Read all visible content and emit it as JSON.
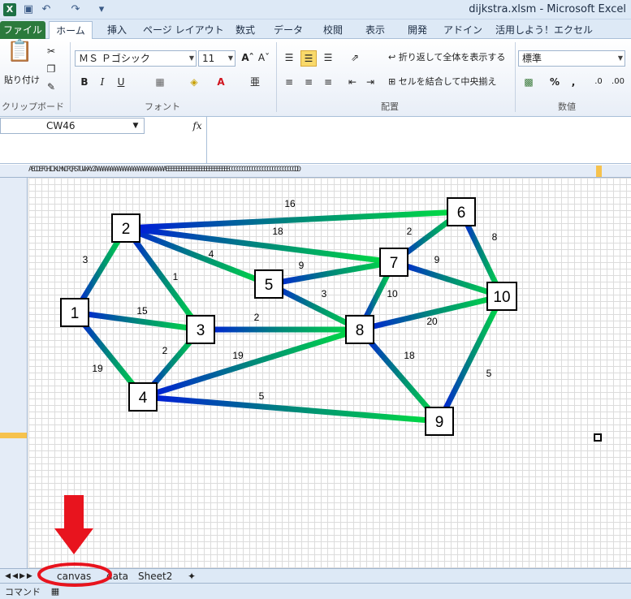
{
  "window": {
    "title": "dijkstra.xlsm - Microsoft Excel"
  },
  "ribbon": {
    "tabs": [
      "ファイル",
      "ホーム",
      "挿入",
      "ページ レイアウト",
      "数式",
      "データ",
      "校閲",
      "表示",
      "開発",
      "アドイン",
      "活用しよう！エクセル"
    ],
    "clipboard": {
      "paste_label": "貼り付け",
      "group_label": "クリップボード"
    },
    "font": {
      "name": "ＭＳ Ｐゴシック",
      "size": "11",
      "group_label": "フォント"
    },
    "alignment": {
      "wrap_label": "折り返して全体を表示する",
      "merge_label": "セルを結合して中央揃え",
      "group_label": "配置"
    },
    "number": {
      "format": "標準",
      "group_label": "数値"
    }
  },
  "formula_bar": {
    "name_box": "CW46",
    "fx": "fx",
    "formula": ""
  },
  "column_header_letters": "AECDEFGHIJKLMNOPQRSTUVWXYZAAAAAAAAAAAAAAAAAAAAAAAAAAAAEEEEEEEEEEEEEEEEEEEEEEEEECCCCCCCCCCCCCCCCCCCCCCCCCCDD",
  "sheet_tabs": [
    "canvas",
    "data",
    "Sheet2"
  ],
  "status": {
    "text": "コマンド"
  },
  "colors": {
    "node_fill": "#ffffff",
    "node_border": "#000000",
    "edge_start": "#0014e0",
    "edge_mid": "#00887a",
    "edge_end": "#00e040",
    "annotation_red": "#e8141e"
  },
  "chart_data": {
    "type": "graph",
    "nodes": [
      "1",
      "2",
      "3",
      "4",
      "5",
      "6",
      "7",
      "8",
      "9",
      "10"
    ],
    "edges": [
      {
        "from": "1",
        "to": "2",
        "weight": "3"
      },
      {
        "from": "1",
        "to": "3",
        "weight": "15"
      },
      {
        "from": "1",
        "to": "4",
        "weight": "19"
      },
      {
        "from": "2",
        "to": "3",
        "weight": "1"
      },
      {
        "from": "2",
        "to": "5",
        "weight": "4"
      },
      {
        "from": "2",
        "to": "6",
        "weight": "16"
      },
      {
        "from": "2",
        "to": "7",
        "weight": "18"
      },
      {
        "from": "3",
        "to": "4",
        "weight": "2"
      },
      {
        "from": "3",
        "to": "8",
        "weight": "2"
      },
      {
        "from": "4",
        "to": "8",
        "weight": "19"
      },
      {
        "from": "4",
        "to": "9",
        "weight": "5"
      },
      {
        "from": "5",
        "to": "7",
        "weight": "9"
      },
      {
        "from": "5",
        "to": "8",
        "weight": "3"
      },
      {
        "from": "6",
        "to": "7",
        "weight": "2"
      },
      {
        "from": "6",
        "to": "10",
        "weight": "8"
      },
      {
        "from": "7",
        "to": "8",
        "weight": "10"
      },
      {
        "from": "7",
        "to": "10",
        "weight": "9"
      },
      {
        "from": "8",
        "to": "9",
        "weight": "18"
      },
      {
        "from": "8",
        "to": "10",
        "weight": "20"
      },
      {
        "from": "9",
        "to": "10",
        "weight": "5"
      }
    ]
  }
}
